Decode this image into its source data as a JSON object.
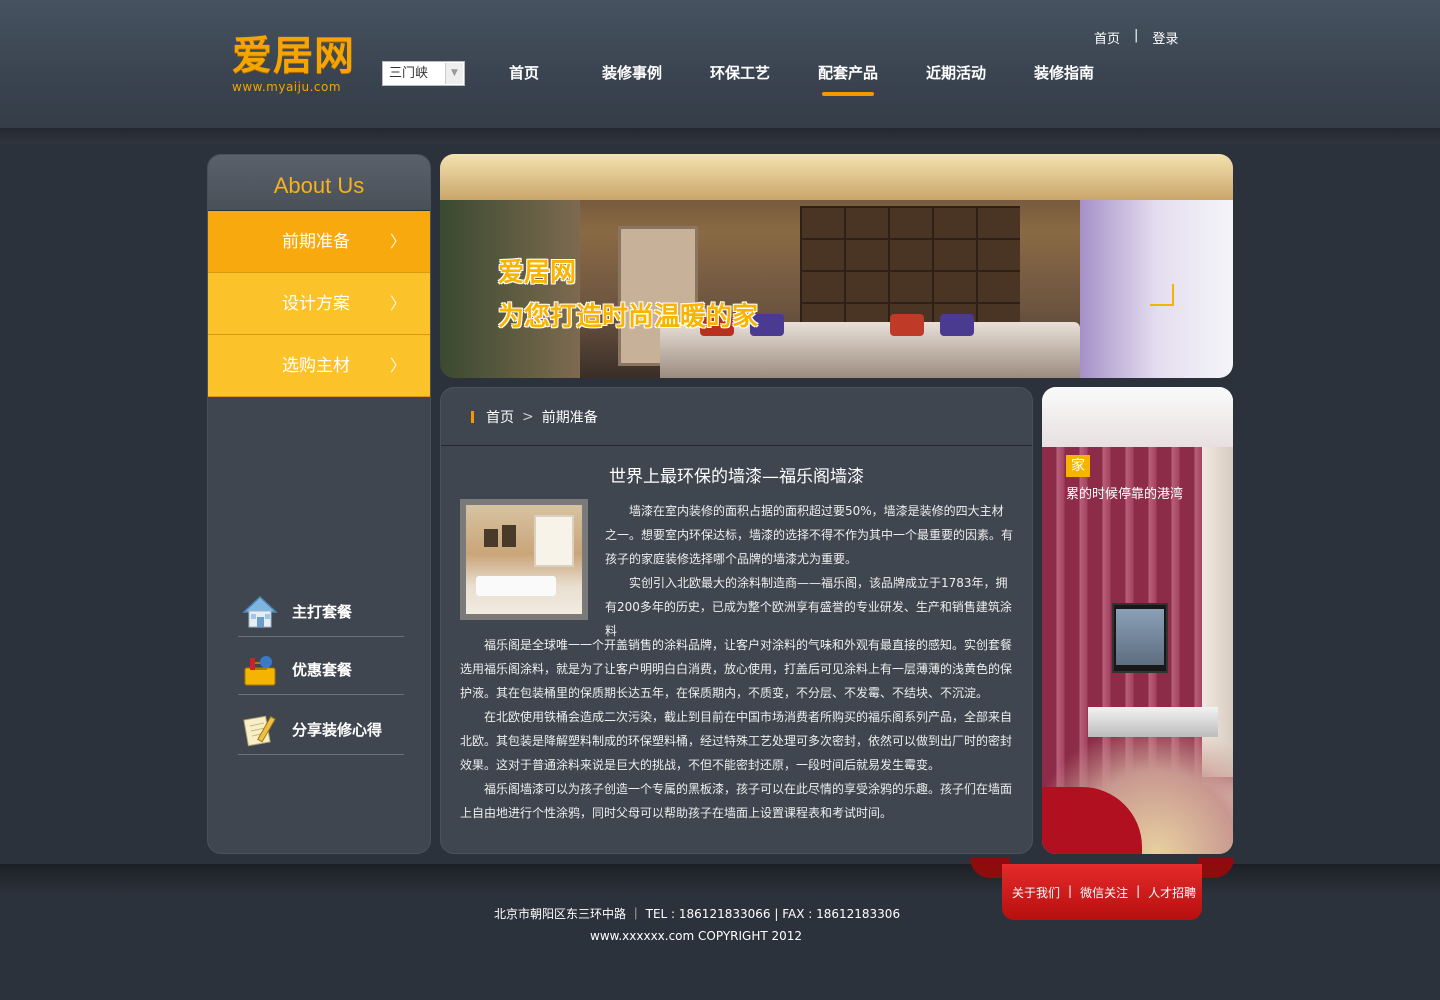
{
  "logo": {
    "name": "爱居网",
    "url": "www.myaiju.com"
  },
  "city_select": {
    "value": "三门峡"
  },
  "nav": {
    "items": [
      "首页",
      "装修事例",
      "环保工艺",
      "配套产品",
      "近期活动",
      "装修指南"
    ],
    "active_index": 3
  },
  "top_links": {
    "home": "首页",
    "separator": "|",
    "login": "登录"
  },
  "sidebar": {
    "title": "About Us",
    "menu": [
      "前期准备",
      "设计方案",
      "选购主材"
    ],
    "active_index": 0,
    "packages": [
      "主打套餐",
      "优惠套餐",
      "分享装修心得"
    ]
  },
  "banner": {
    "title": "爱居网",
    "subtitle": "为您打造时尚温暖的家"
  },
  "breadcrumb": {
    "home": "首页",
    "current": "前期准备"
  },
  "article": {
    "title": "世界上最环保的墙漆—福乐阁墙漆",
    "para1": "墙漆在室内装修的面积占据的面积超过要50%，墙漆是装修的四大主材之一。想要室内环保达标，墙漆的选择不得不作为其中一个最重要的因素。有孩子的家庭装修选择哪个品牌的墙漆尤为重要。",
    "para2": "实创引入北欧最大的涂料制造商——福乐阁，该品牌成立于1783年，拥有200多年的历史，已成为整个欧洲享有盛誉的专业研发、生产和销售建筑涂料",
    "para3": "福乐阁是全球唯一一个开盖销售的涂料品牌，让客户对涂料的气味和外观有最直接的感知。实创套餐选用福乐阁涂料，就是为了让客户明明白白消费，放心使用，打盖后可见涂料上有一层薄薄的浅黄色的保护液。其在包装桶里的保质期长达五年，在保质期内，不质变，不分层、不发霉、不结块、不沉淀。",
    "para4": "在北欧使用铁桶会造成二次污染，截止到目前在中国市场消费者所购买的福乐阁系列产品，全部来自北欧。其包装是降解塑料制成的环保塑料桶，经过特殊工艺处理可多次密封，依然可以做到出厂时的密封效果。这对于普通涂料来说是巨大的挑战，不但不能密封还原，一段时间后就易发生霉变。",
    "para5": "福乐阁墙漆可以为孩子创造一个专属的黑板漆，孩子可以在此尽情的享受涂鸦的乐趣。孩子们在墙面上自由地进行个性涂鸦，同时父母可以帮助孩子在墙面上设置课程表和考试时间。"
  },
  "promo": {
    "badge": "家",
    "tagline": "累的时候停靠的港湾"
  },
  "footer": {
    "links": [
      "关于我们",
      "|",
      "微信关注",
      "|",
      "人才招聘"
    ],
    "address": "北京市朝阳区东三环中路 ｜ TEL : 186121833066 | FAX : 18612183306",
    "copyright": "www.xxxxxx.com COPYRIGHT 2012"
  },
  "colors": {
    "accent": "#f39800",
    "menu_active": "#f7a90d",
    "menu_normal": "#fcc22a",
    "footer_ribbon": "#d41a1a"
  }
}
